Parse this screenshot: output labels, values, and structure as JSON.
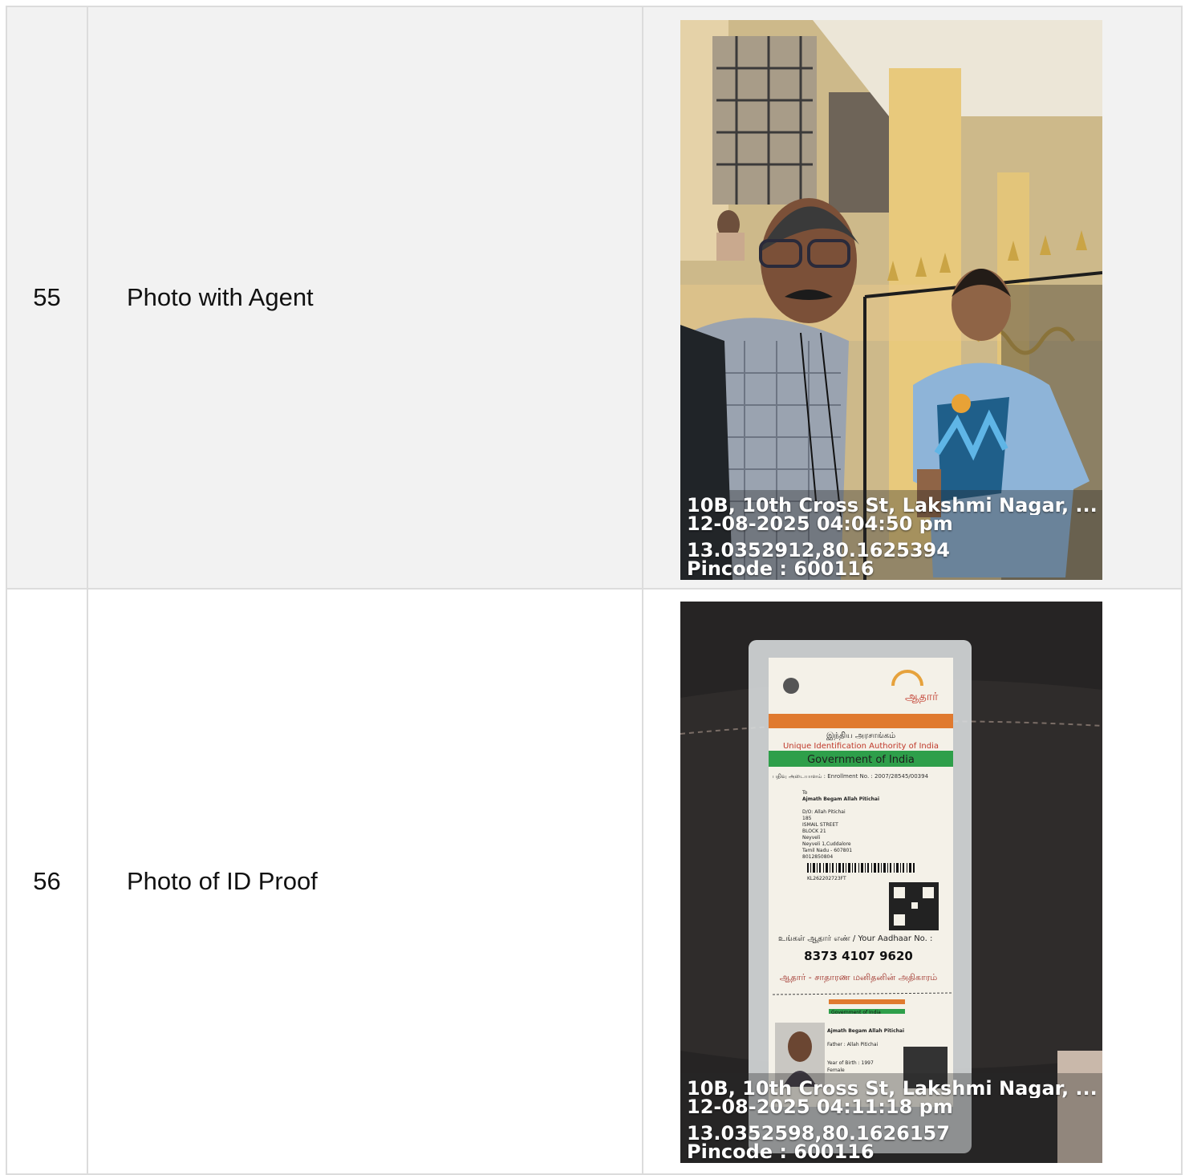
{
  "rows": [
    {
      "number": "55",
      "label": "Photo with Agent",
      "photo_icon": "selfie-photo",
      "stamp": {
        "address": "10B, 10th Cross St, Lakshmi Nagar, ...",
        "datetime": "12-08-2025 04:04:50 pm",
        "coords": "13.0352912,80.1625394",
        "pincode": "Pincode : 600116"
      }
    },
    {
      "number": "56",
      "label": "Photo of ID Proof",
      "photo_icon": "id-card-photo",
      "stamp": {
        "address": "10B, 10th Cross St, Lakshmi Nagar, ...",
        "datetime": "12-08-2025 04:11:18 pm",
        "coords": "13.0352598,80.1626157",
        "pincode": "Pincode : 600116"
      },
      "card": {
        "header_tamil": "இந்திய அரசாங்கம்",
        "uidai": "Unique Identification Authority of India",
        "govt": "Government of India",
        "enrollment": "பதிவு அடையாளம் : Enrollment No. : 2007/28545/00394",
        "address_lines": [
          "To",
          "Ajmath Begam Allah Pitichai",
          "D/O: Allah Pitichai",
          "185",
          "ISMAIL STREET",
          "BLOCK 21",
          "Neyveli",
          "Neyveli 1,Cuddalore",
          "Tamil Nadu - 607801",
          "8012850804"
        ],
        "barcode_id": "KL262202723FT",
        "aadhaar_label": "உங்கள் ஆதார் எண் / Your Aadhaar No. :",
        "aadhaar_number": "8373 4107 9620",
        "slogan": "ஆதார் - சாதாரண மனிதனின் அதிகாரம்",
        "lower_govt": "Government of India",
        "holder_name": "Ajmath Begam Allah Pitichai",
        "father": "Father : Allah Pitichai",
        "yob": "Year of Birth : 1997",
        "gender": "Female",
        "logo": "ஆதார்"
      }
    }
  ]
}
